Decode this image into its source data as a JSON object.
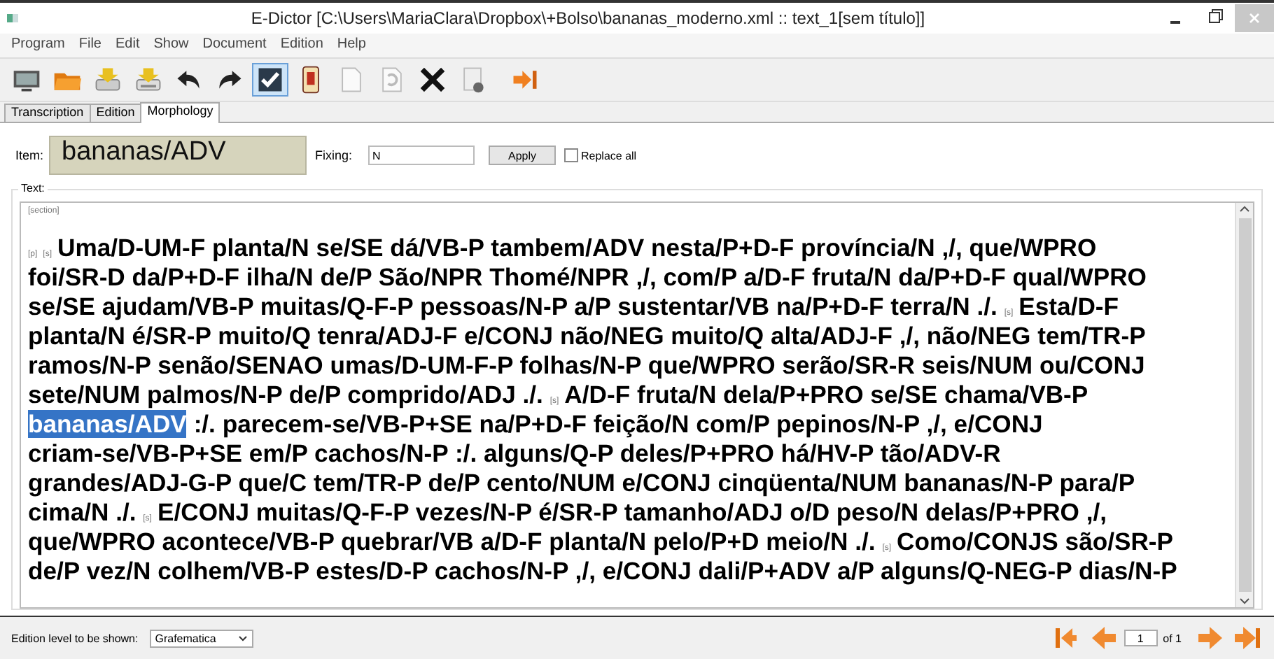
{
  "window": {
    "title": "E-Dictor [C:\\Users\\MariaClara\\Dropbox\\+Bolso\\bananas_moderno.xml :: text_1[sem título]]"
  },
  "menu": [
    "Program",
    "File",
    "Edit",
    "Show",
    "Document",
    "Edition",
    "Help"
  ],
  "toolbar": [
    {
      "kind": "monitor",
      "selected": false
    },
    {
      "kind": "folder",
      "selected": false
    },
    {
      "kind": "save",
      "selected": false
    },
    {
      "kind": "save-as",
      "selected": false
    },
    {
      "kind": "undo",
      "selected": false
    },
    {
      "kind": "redo",
      "selected": false
    },
    {
      "kind": "check",
      "selected": true
    },
    {
      "kind": "card",
      "selected": false
    },
    {
      "kind": "page",
      "selected": false
    },
    {
      "kind": "page-rotate",
      "selected": false
    },
    {
      "kind": "delete",
      "selected": false
    },
    {
      "kind": "page-add",
      "selected": false
    },
    {
      "kind": "exit",
      "selected": false
    }
  ],
  "tabs": [
    {
      "label": "Transcription",
      "selected": false
    },
    {
      "label": "Edition",
      "selected": false
    },
    {
      "label": "Morphology",
      "selected": true
    }
  ],
  "item": {
    "label": "Item:",
    "value": "bananas/ADV"
  },
  "fixing": {
    "label": "Fixing:",
    "value": "N"
  },
  "apply_button": "Apply",
  "replace_all": {
    "label": "Replace all",
    "checked": false
  },
  "text_group": {
    "label": "Text:",
    "section": "[section]",
    "lines": [
      [
        {
          "kind": "mark",
          "text": "[p]"
        },
        {
          "kind": "mark",
          "text": "[s]"
        },
        {
          "kind": "word",
          "text": "Uma/D-UM-F planta/N se/SE dá/VB-P tambem/ADV nesta/P+D-F província/N ,/, que/WPRO"
        }
      ],
      [
        {
          "kind": "word",
          "text": "foi/SR-D da/P+D-F ilha/N de/P São/NPR Thomé/NPR ,/, com/P a/D-F fruta/N da/P+D-F qual/WPRO"
        }
      ],
      [
        {
          "kind": "word",
          "text": "se/SE ajudam/VB-P muitas/Q-F-P pessoas/N-P a/P sustentar/VB na/P+D-F terra/N ./."
        },
        {
          "kind": "mark",
          "text": "[s]"
        },
        {
          "kind": "word",
          "text": "Esta/D-F"
        }
      ],
      [
        {
          "kind": "word",
          "text": "planta/N é/SR-P muito/Q tenra/ADJ-F e/CONJ não/NEG muito/Q alta/ADJ-F ,/, não/NEG tem/TR-P"
        }
      ],
      [
        {
          "kind": "word",
          "text": "ramos/N-P senão/SENAO umas/D-UM-F-P folhas/N-P que/WPRO serão/SR-R seis/NUM ou/CONJ"
        }
      ],
      [
        {
          "kind": "word",
          "text": "sete/NUM palmos/N-P de/P comprido/ADJ ./."
        },
        {
          "kind": "mark",
          "text": "[s]"
        },
        {
          "kind": "word",
          "text": "A/D-F fruta/N dela/P+PRO se/SE chama/VB-P"
        }
      ],
      [
        {
          "kind": "selected",
          "text": "bananas/ADV"
        },
        {
          "kind": "word",
          "text": ":/. parecem-se/VB-P+SE na/P+D-F feição/N com/P pepinos/N-P ,/, e/CONJ"
        }
      ],
      [
        {
          "kind": "word",
          "text": "criam-se/VB-P+SE em/P cachos/N-P :/. alguns/Q-P deles/P+PRO há/HV-P tão/ADV-R"
        }
      ],
      [
        {
          "kind": "word",
          "text": "grandes/ADJ-G-P que/C tem/TR-P de/P cento/NUM e/CONJ cinqüenta/NUM bananas/N-P para/P"
        }
      ],
      [
        {
          "kind": "word",
          "text": "cima/N ./."
        },
        {
          "kind": "mark",
          "text": "[s]"
        },
        {
          "kind": "word",
          "text": "E/CONJ muitas/Q-F-P vezes/N-P é/SR-P tamanho/ADJ o/D peso/N delas/P+PRO ,/,"
        }
      ],
      [
        {
          "kind": "word",
          "text": "que/WPRO acontece/VB-P quebrar/VB a/D-F planta/N pelo/P+D meio/N ./."
        },
        {
          "kind": "mark",
          "text": "[s]"
        },
        {
          "kind": "word",
          "text": "Como/CONJS são/SR-P"
        }
      ],
      [
        {
          "kind": "word",
          "text": "de/P vez/N colhem/VB-P estes/D-P cachos/N-P ,/, e/CONJ dali/P+ADV a/P alguns/Q-NEG-P dias/N-P"
        }
      ]
    ]
  },
  "footer": {
    "level_label": "Edition level to be shown:",
    "level_value": "Grafematica",
    "page": "1",
    "page_total": "of 1"
  }
}
